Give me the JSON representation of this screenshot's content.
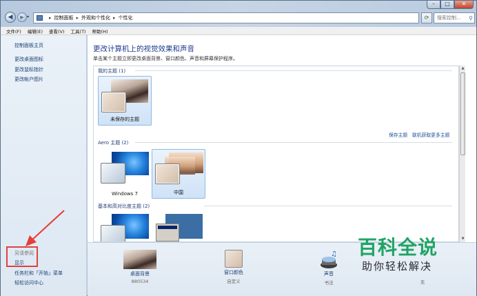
{
  "address_bar": {
    "crumbs": [
      "控制面板",
      "外观和个性化",
      "个性化"
    ],
    "search_placeholder": "搜索控制..."
  },
  "window_buttons": {
    "minimize": "–",
    "maximize": "□",
    "close": "✕"
  },
  "menu": [
    "文件(F)",
    "编辑(E)",
    "查看(V)",
    "工具(T)",
    "帮助(H)"
  ],
  "sidebar": {
    "home": "控制面板主页",
    "links": [
      "更改桌面图标",
      "更改鼠标指针",
      "更改帐户图片"
    ],
    "see_also_title": "另请参阅",
    "see_also": [
      "显示",
      "任务栏和「开始」菜单",
      "轻松访问中心"
    ]
  },
  "main": {
    "title": "更改计算机上的视觉效果和声音",
    "subtitle": "单击某个主题立即更改桌面背景、窗口颜色、声音和屏幕保护程序。",
    "groups": {
      "my_themes": {
        "header": "我的主题 (1)",
        "themes": [
          {
            "name": "未保存的主题"
          }
        ]
      },
      "aero": {
        "header": "Aero 主题 (2)",
        "themes": [
          {
            "name": "Windows 7"
          },
          {
            "name": "中国"
          }
        ]
      },
      "basic": {
        "header": "基本和高对比度主题 (2)"
      }
    },
    "save_theme": "保存主题",
    "get_more": "联机获取更多主题"
  },
  "bottom": {
    "desktop_background": {
      "label": "桌面背景",
      "value": "880534"
    },
    "window_color": {
      "label": "窗口颜色",
      "value": "自定义"
    },
    "sounds": {
      "label": "声音",
      "value": "书法"
    },
    "screensaver": {
      "value": "无"
    }
  },
  "watermark": {
    "main": "百科全说",
    "sub": "助你轻松解决"
  },
  "colors": {
    "link": "#1d3f73",
    "title": "#1a3a8c",
    "annotation_red": "#e4403a",
    "watermark_green": "#1fa463"
  }
}
